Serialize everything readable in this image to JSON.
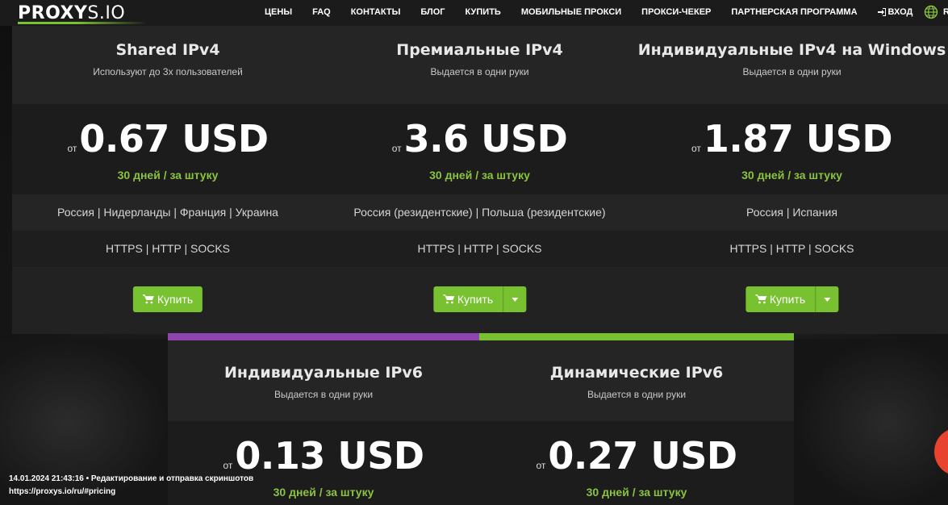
{
  "header": {
    "logo_bold": "PROXY",
    "logo_thin": "S.IO",
    "nav": [
      "ЦЕНЫ",
      "FAQ",
      "КОНТАКТЫ",
      "БЛОГ",
      "КУПИТЬ",
      "МОБИЛЬНЫЕ ПРОКСИ",
      "ПРОКСИ-ЧЕКЕР",
      "ПАРТНЕРСКАЯ ПРОГРАММА"
    ],
    "login": "ВХОД",
    "lang": "RU"
  },
  "price_from": "от",
  "buy_label": "Купить",
  "cards": [
    {
      "title": "Shared IPv4",
      "subtitle": "Используют до 3х пользователей",
      "price": "0.67 USD",
      "period": "30 дней / за штуку",
      "countries": "Россия | Нидерланды | Франция | Украина",
      "protocols": "HTTPS | HTTP | SOCKS"
    },
    {
      "title": "Премиальные IPv4",
      "subtitle": "Выдается в одни руки",
      "price": "3.6 USD",
      "period": "30 дней / за штуку",
      "countries": "Россия (резидентские) | Польша (резидентские)",
      "protocols": "HTTPS | HTTP | SOCKS"
    },
    {
      "title": "Индивидуальные IPv4 на Windows",
      "subtitle": "Выдается в одни руки",
      "price": "1.87 USD",
      "period": "30 дней / за штуку",
      "countries": "Россия | Испания",
      "protocols": "HTTPS | HTTP | SOCKS"
    },
    {
      "title": "Индивидуальные IPv6",
      "subtitle": "Выдается в одни руки",
      "price": "0.13 USD",
      "period": "30 дней / за штуку",
      "accent": "#8e44ad"
    },
    {
      "title": "Динамические IPv6",
      "subtitle": "Выдается в одни руки",
      "price": "0.27 USD",
      "period": "30 дней / за штуку",
      "accent": "#78c130"
    }
  ],
  "screenshot_meta": {
    "line1": "14.01.2024 21:43:16 • Редактирование и отправка скриншотов",
    "line2": "https://proxys.io/ru/#pricing"
  },
  "colors": {
    "brand_green": "#78c130",
    "period_green": "#8ac43f",
    "purple_accent": "#8e44ad"
  }
}
